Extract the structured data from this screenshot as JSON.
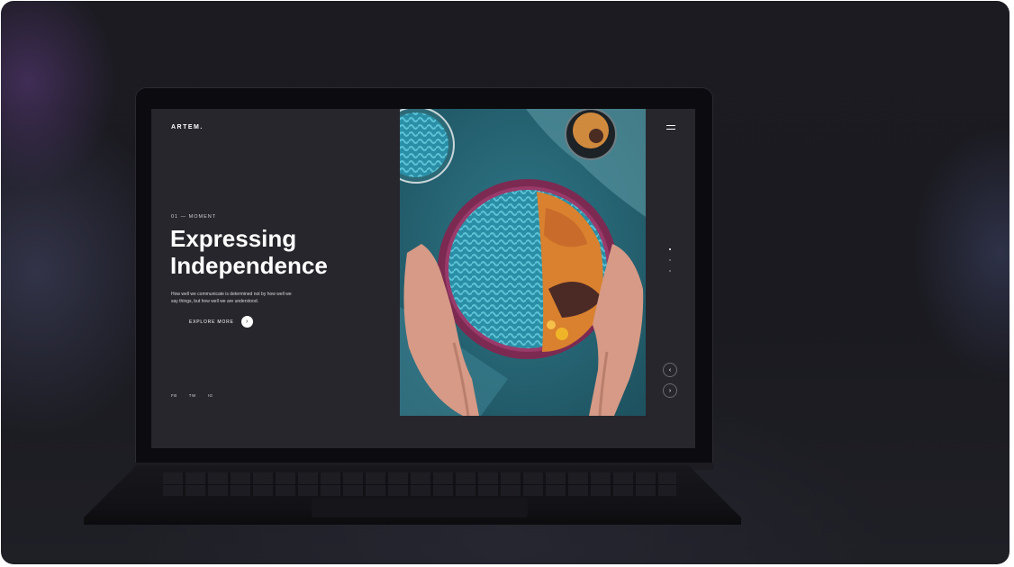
{
  "site": {
    "logo": "ARTEM.",
    "eyebrow": "01 — MOMENT",
    "headline_line1": "Expressing",
    "headline_line2": "Independence",
    "body": "How well we communicate is determined not by how well we say things, but how well we are understood.",
    "cta_label": "EXPLORE MORE",
    "cta_icon": "arrow-right-icon",
    "social": [
      "FB",
      "TW",
      "IG"
    ],
    "slider_dots": 3,
    "active_slide": 1,
    "prev_icon": "chevron-left-icon",
    "next_icon": "chevron-right-icon",
    "menu_icon": "hamburger-menu-icon",
    "photo_subject": "hands holding pink bowl of blue fusilli pasta with roasted squash on teal cloth"
  },
  "colors": {
    "background": "#1b1b21",
    "screen": "#27262c",
    "text": "#ffffff",
    "photo_teal": "#2a6a78",
    "bowl_pink": "#8a2f5a",
    "pasta_blue": "#3fa7bd",
    "squash_orange": "#e08a30"
  }
}
